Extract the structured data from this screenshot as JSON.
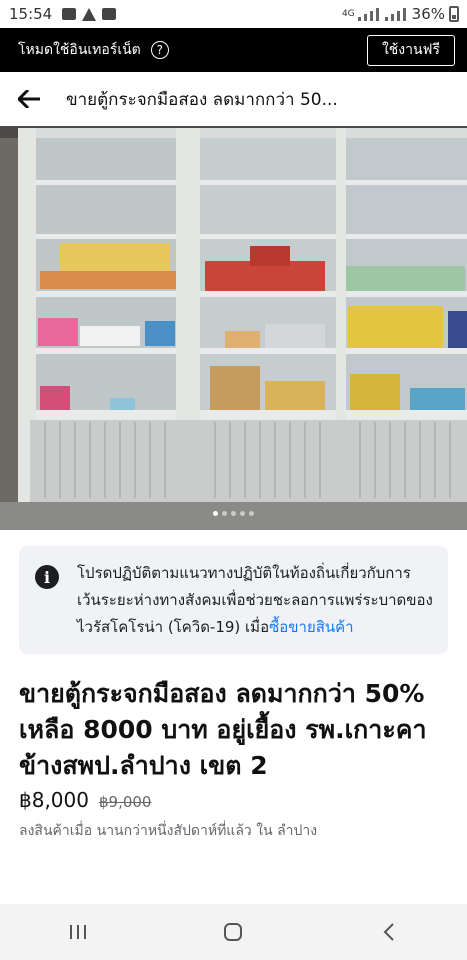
{
  "status_bar": {
    "time": "15:54",
    "battery": "36%",
    "network": "4G"
  },
  "banner": {
    "label": "โหมดใช้อินเทอร์เน็ต",
    "help_glyph": "?",
    "button": "ใช้งานฟรี"
  },
  "header": {
    "title": "ขายตู้กระจกมือสอง ลดมากกว่า 50..."
  },
  "carousel": {
    "total_photos": 5,
    "active_index": 0
  },
  "notice": {
    "icon": "info-icon",
    "text": "โปรดปฏิบัติตามแนวทางปฏิบัติในท้องถิ่นเกี่ยวกับการเว้นระยะห่างทางสังคมเพื่อช่วยชะลอการแพร่ระบาดของไวรัสโคโรน่า (โควิด-19) เมื่อ",
    "link": "ซื้อขายสินค้า"
  },
  "listing": {
    "title": "ขายตู้กระจกมือสอง ลดมากกว่า 50% เหลือ 8000 บาท อยู่เยื้อง รพ.เกาะคา ข้างสพป.ลำปาง เขต 2",
    "price": "฿8,000",
    "original_price": "฿9,000",
    "meta": "ลงสินค้าเมื่อ นานกว่าหนึ่งสัปดาห์ที่แล้ว ใน ลำปาง"
  },
  "nav_bar": {
    "recents": "recents-icon",
    "home": "home-icon",
    "back": "back-icon"
  },
  "colors": {
    "link": "#1877f2",
    "banner_bg": "#000000",
    "notice_bg": "#f0f2f5",
    "muted": "#65676b"
  }
}
